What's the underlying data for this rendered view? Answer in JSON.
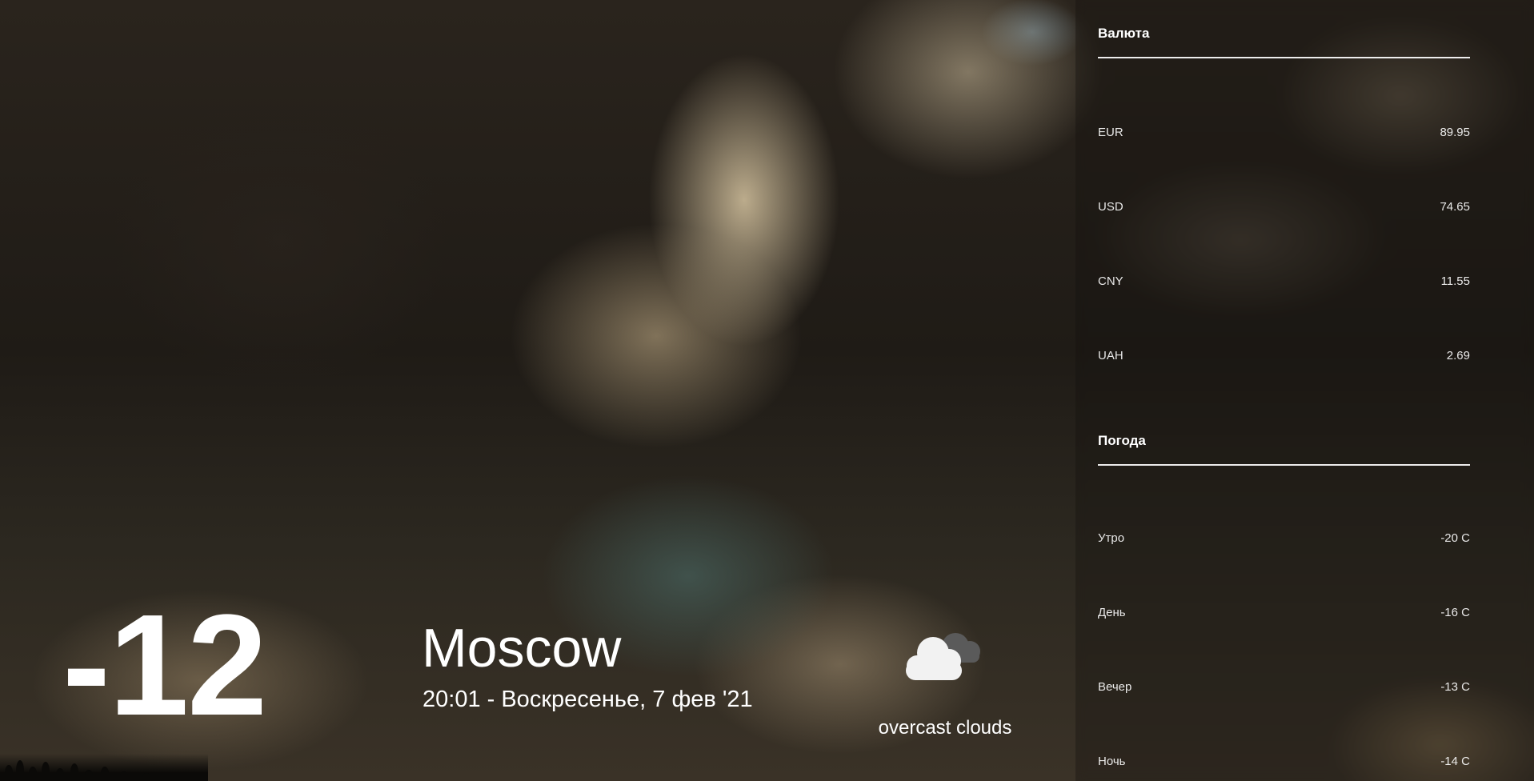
{
  "current": {
    "temperature": "-12",
    "city": "Moscow",
    "datetime": "20:01 - Воскресенье, 7 фев '21",
    "condition_icon": "overcast-clouds-icon",
    "condition_text": "overcast clouds"
  },
  "currency": {
    "title": "Валюта",
    "rows": [
      {
        "label": "EUR",
        "value": "89.95"
      },
      {
        "label": "USD",
        "value": "74.65"
      },
      {
        "label": "CNY",
        "value": "11.55"
      },
      {
        "label": "UAH",
        "value": "2.69"
      }
    ]
  },
  "weather": {
    "title": "Погода",
    "rows": [
      {
        "label": "Утро",
        "value": "-20 C"
      },
      {
        "label": "День",
        "value": "-16 C"
      },
      {
        "label": "Вечер",
        "value": "-13 C"
      },
      {
        "label": "Ночь",
        "value": "-14 C"
      }
    ]
  },
  "colors": {
    "text": "#ffffff",
    "divider": "#ffffff",
    "icon_cloud_front": "#f2f2f2",
    "icon_cloud_back": "#5a5a5a"
  }
}
